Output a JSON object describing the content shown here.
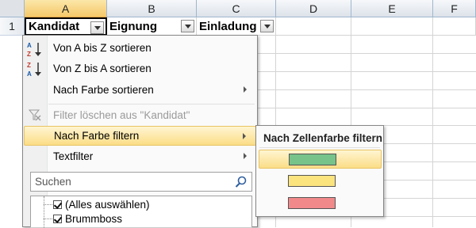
{
  "sheet": {
    "columns": [
      "A",
      "B",
      "C",
      "D",
      "E",
      "F"
    ],
    "rows": [
      "1"
    ],
    "header_cells": [
      "Kandidat",
      "Eignung",
      "Einladung"
    ]
  },
  "filter_menu": {
    "items": [
      {
        "label": "Von A bis Z sortieren",
        "icon": "sort-a-to-z-icon"
      },
      {
        "label": "Von Z bis A sortieren",
        "icon": "sort-z-to-a-icon"
      },
      {
        "label": "Nach Farbe sortieren",
        "submenu": true
      },
      {
        "label": "Filter löschen aus \"Kandidat\"",
        "icon": "clear-filter-icon",
        "disabled": true
      },
      {
        "label": "Nach Farbe filtern",
        "submenu": true,
        "highlighted": true
      },
      {
        "label": "Textfilter",
        "submenu": true
      }
    ],
    "search_placeholder": "Suchen",
    "list": [
      "(Alles auswählen)",
      "Brummboss"
    ]
  },
  "color_submenu": {
    "title": "Nach Zellenfarbe filtern",
    "colors": [
      "#77c38a",
      "#fbe37e",
      "#f1898b"
    ]
  }
}
